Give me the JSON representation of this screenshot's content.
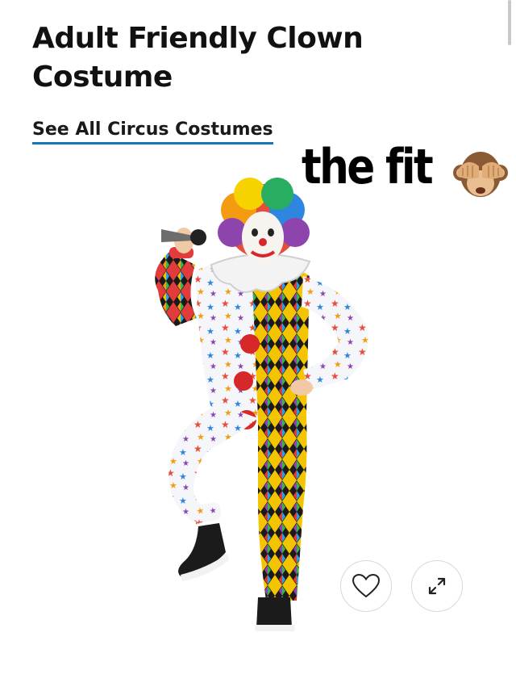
{
  "product": {
    "title": "Adult Friendly Clown Costume",
    "see_all_link": "See All Circus Costumes"
  },
  "overlay": {
    "caption": "the fit",
    "emoji": "see-no-evil-monkey-icon"
  },
  "actions": {
    "favorite_icon": "heart-icon",
    "zoom_icon": "expand-arrows-icon"
  },
  "colors": {
    "link_underline": "#1577b8",
    "text": "#111111"
  }
}
